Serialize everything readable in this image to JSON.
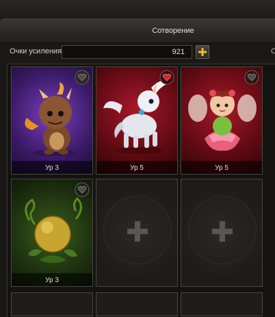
{
  "window": {
    "tab_title": "Сотворение"
  },
  "points": {
    "label": "Очки усиления",
    "value": "921",
    "right_fragment": "О"
  },
  "cards": [
    {
      "level": "Ур 3",
      "favorite": false,
      "bg": "purple",
      "creature": "brown-dragon-pet"
    },
    {
      "level": "Ур 5",
      "favorite": true,
      "bg": "crimson",
      "creature": "white-pegasus-pet"
    },
    {
      "level": "Ур 5",
      "favorite": false,
      "bg": "crimson",
      "creature": "flower-fairy-pet"
    },
    {
      "level": "Ур 3",
      "favorite": false,
      "bg": "green",
      "creature": "golden-seed-pet"
    }
  ],
  "colors": {
    "purple": "#5a2a8c",
    "crimson": "#7a0f18",
    "green": "#2e4a16",
    "heart_active": "#d9222a"
  }
}
